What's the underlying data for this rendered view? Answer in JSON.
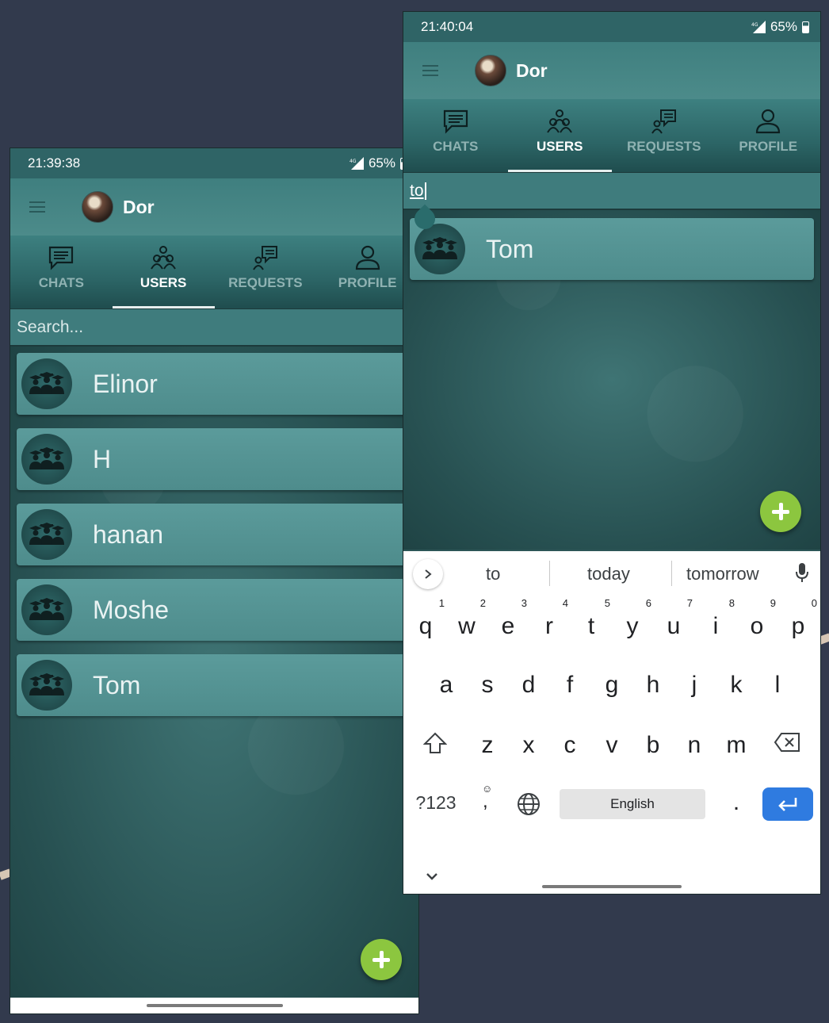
{
  "colors": {
    "background": "#323a4d",
    "accent_fab": "#8cc63f",
    "enter_key": "#2f7be0"
  },
  "left_screen": {
    "status": {
      "time": "21:39:38",
      "battery": "65%"
    },
    "app_bar": {
      "title": "Dor"
    },
    "tabs": [
      {
        "label": "CHATS",
        "icon": "chat-icon",
        "active": false
      },
      {
        "label": "USERS",
        "icon": "users-icon",
        "active": true
      },
      {
        "label": "REQUESTS",
        "icon": "requests-icon",
        "active": false
      },
      {
        "label": "PROFILE",
        "icon": "profile-icon",
        "active": false
      }
    ],
    "search": {
      "placeholder": "Search..."
    },
    "users": [
      "Elinor",
      "H",
      "hanan",
      "Moshe",
      "Tom"
    ]
  },
  "right_screen": {
    "status": {
      "time": "21:40:04",
      "battery": "65%"
    },
    "app_bar": {
      "title": "Dor"
    },
    "tabs": [
      {
        "label": "CHATS",
        "icon": "chat-icon",
        "active": false
      },
      {
        "label": "USERS",
        "icon": "users-icon",
        "active": true
      },
      {
        "label": "REQUESTS",
        "icon": "requests-icon",
        "active": false
      },
      {
        "label": "PROFILE",
        "icon": "profile-icon",
        "active": false
      }
    ],
    "search": {
      "value": "to"
    },
    "users": [
      "Tom"
    ],
    "keyboard": {
      "suggestions": [
        "to",
        "today",
        "tomorrow"
      ],
      "row1": [
        {
          "k": "q",
          "n": "1"
        },
        {
          "k": "w",
          "n": "2"
        },
        {
          "k": "e",
          "n": "3"
        },
        {
          "k": "r",
          "n": "4"
        },
        {
          "k": "t",
          "n": "5"
        },
        {
          "k": "y",
          "n": "6"
        },
        {
          "k": "u",
          "n": "7"
        },
        {
          "k": "i",
          "n": "8"
        },
        {
          "k": "o",
          "n": "9"
        },
        {
          "k": "p",
          "n": "0"
        }
      ],
      "row2": [
        "a",
        "s",
        "d",
        "f",
        "g",
        "h",
        "j",
        "k",
        "l"
      ],
      "row3": [
        "z",
        "x",
        "c",
        "v",
        "b",
        "n",
        "m"
      ],
      "symbols_label": "?123",
      "comma_label": ",",
      "space_label": "English",
      "period_label": "."
    }
  }
}
